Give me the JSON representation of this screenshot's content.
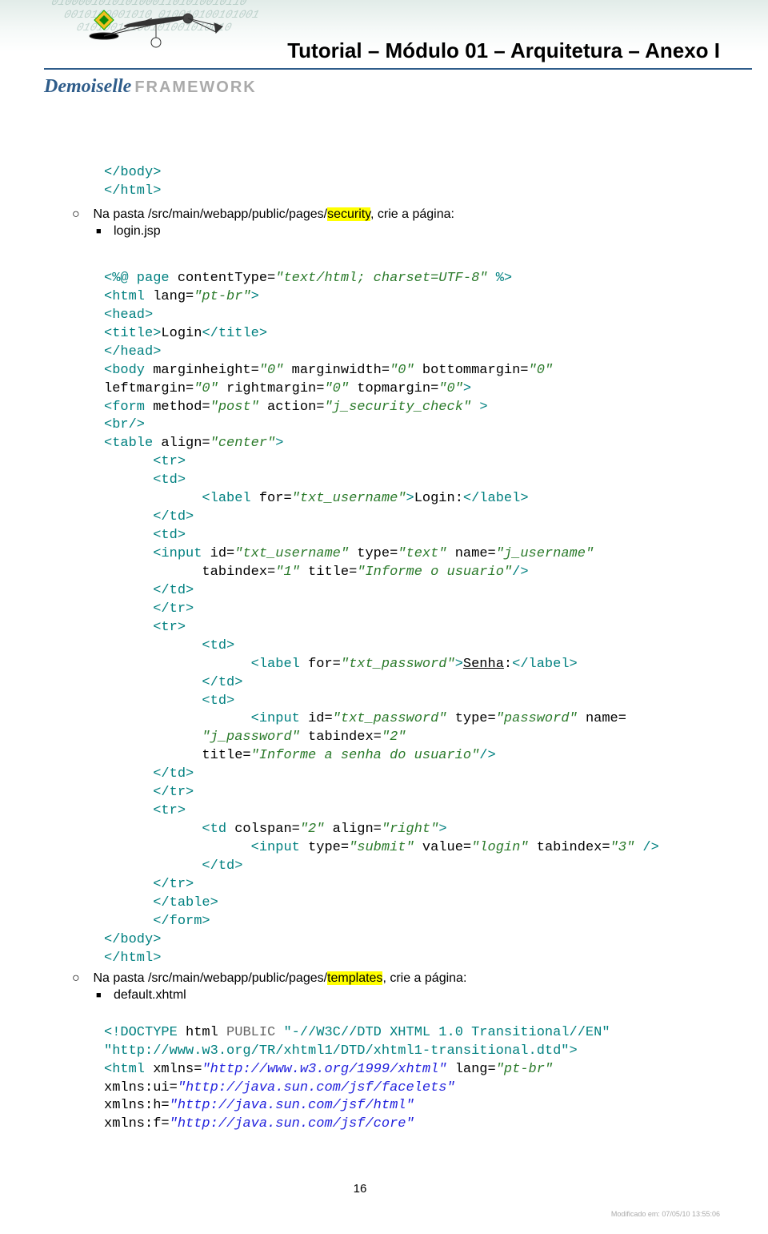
{
  "header": {
    "title": "Tutorial – Módulo 01 – Arquitetura – Anexo I",
    "logo_main": "Demoiselle",
    "logo_sub": "FRAMEWORK"
  },
  "instr1_prefix": "Na pasta /src/main/webapp/public/pages/",
  "instr1_hl": "security",
  "instr1_suffix": ", crie a página:",
  "instr1_file": "login.jsp",
  "instr2_prefix": "Na pasta /src/main/webapp/public/pages/",
  "instr2_hl": "templates",
  "instr2_suffix": ", crie a página:",
  "instr2_file": "default.xhtml",
  "footer": {
    "page": "16",
    "modified": "Modificado em:  07/05/10 13:55:06"
  }
}
